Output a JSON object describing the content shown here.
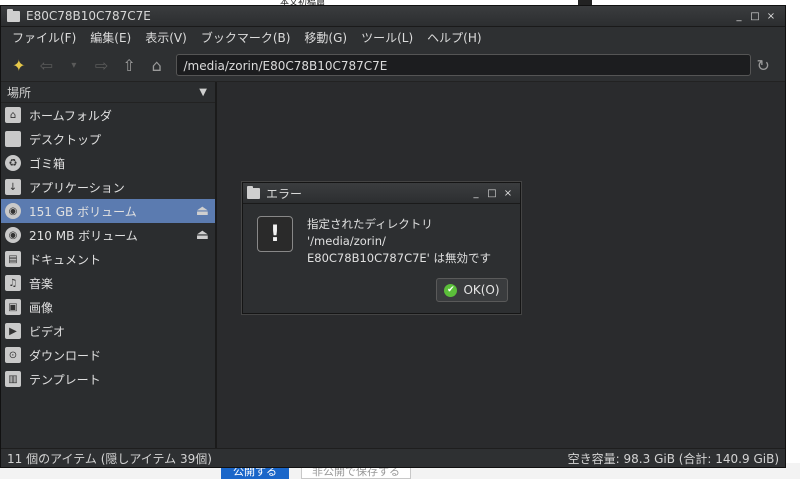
{
  "background": {
    "top_text": "本文初稿篇",
    "primary_button": "公開する",
    "secondary_button": "非公開で保存する"
  },
  "window": {
    "title": "E80C78B10C787C7E",
    "controls": [
      "_",
      "□",
      "×"
    ]
  },
  "menubar": {
    "items": [
      "ファイル(F)",
      "編集(E)",
      "表示(V)",
      "ブックマーク(B)",
      "移動(G)",
      "ツール(L)",
      "ヘルプ(H)"
    ]
  },
  "toolbar": {
    "path": "/media/zorin/E80C78B10C787C7E"
  },
  "sidebar": {
    "header": "場所",
    "items": [
      {
        "label": "ホームフォルダ",
        "icon": "home-icon"
      },
      {
        "label": "デスクトップ",
        "icon": "desktop-icon"
      },
      {
        "label": "ゴミ箱",
        "icon": "trash-icon"
      },
      {
        "label": "アプリケーション",
        "icon": "applications-icon"
      },
      {
        "label": "151 GB ボリューム",
        "icon": "drive-icon",
        "active": true
      },
      {
        "label": "210 MB ボリューム",
        "icon": "drive-icon"
      },
      {
        "label": "ドキュメント",
        "icon": "documents-folder-icon"
      },
      {
        "label": "音楽",
        "icon": "music-folder-icon"
      },
      {
        "label": "画像",
        "icon": "pictures-folder-icon"
      },
      {
        "label": "ビデオ",
        "icon": "videos-folder-icon"
      },
      {
        "label": "ダウンロード",
        "icon": "downloads-folder-icon"
      },
      {
        "label": "テンプレート",
        "icon": "templates-folder-icon"
      }
    ]
  },
  "statusbar": {
    "left": "11 個のアイテム (隠しアイテム 39個)",
    "right": "空き容量: 98.3 GiB (合計: 140.9 GiB)"
  },
  "dialog": {
    "title": "エラー",
    "message_line1": "指定されたディレクトリ '/media/zorin/",
    "message_line2": "E80C78B10C787C7E' は無効です",
    "ok_label": "OK(O)"
  },
  "colors": {
    "active_item": "#5b7bb0",
    "ok_icon": "#5bbf3a",
    "window_bg": "#2b2d2f"
  }
}
